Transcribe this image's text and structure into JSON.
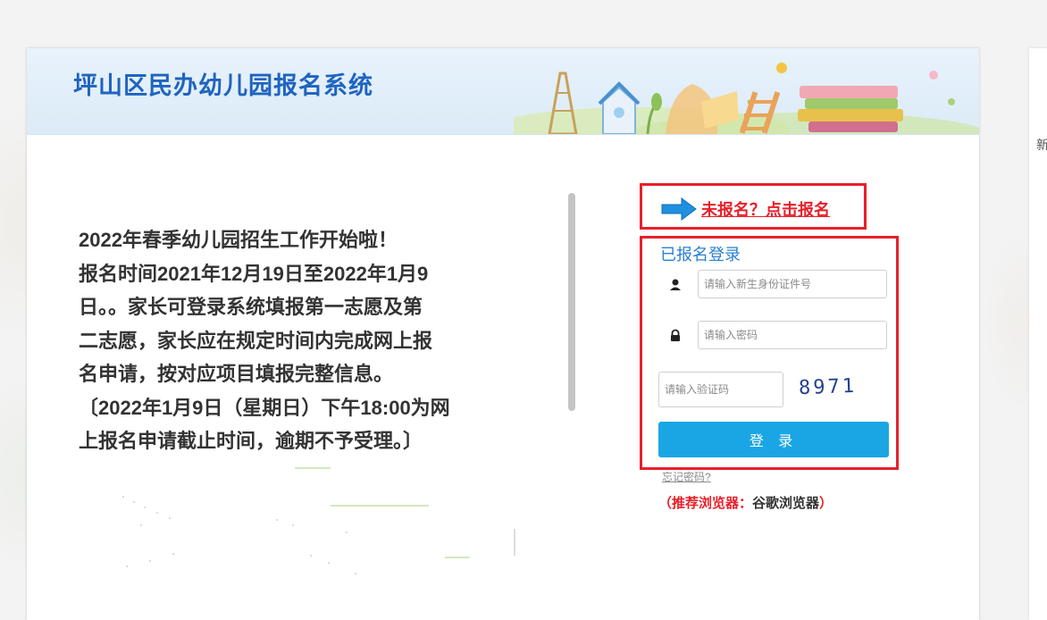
{
  "header": {
    "title": "坪山区民办幼儿园报名系统"
  },
  "notice": {
    "lines": [
      "2022年春季幼儿园招生工作开始啦！",
      "报名时间2021年12月19日至2022年1月9",
      "日。。家长可登录系统填报第一志愿及第",
      "二志愿，家长应在规定时间内完成网上报",
      "名申请，按对应项目填报完整信息。",
      "〔2022年1月9日（星期日）下午18:00为网",
      "上报名申请截止时间，逾期不予受理。〕"
    ]
  },
  "signup": {
    "link_label": "未报名？点击报名",
    "icon": "arrow-right-icon"
  },
  "login": {
    "title": "已报名登录",
    "id_placeholder": "请输入新生身份证件号",
    "id_icon": "user-icon",
    "password_placeholder": "请输入密码",
    "password_icon": "lock-icon",
    "captcha_placeholder": "请输入验证码",
    "captcha_code": "8971",
    "submit_label": "登 录",
    "forgot_label": "忘记密码?",
    "browser_note_prefix": "（推荐浏览器：",
    "browser_note_name": "谷歌浏览器",
    "browser_note_suffix": "）"
  },
  "side_panel": {
    "partial_text": "新"
  },
  "colors": {
    "title_blue": "#1f64c0",
    "highlight_red": "#e8202a",
    "button_blue": "#1aa6e4",
    "link_blue": "#2a7fd1"
  }
}
